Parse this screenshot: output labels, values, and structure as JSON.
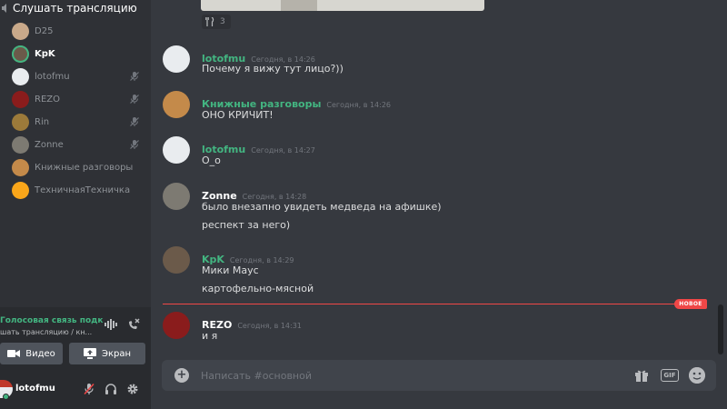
{
  "sidebar": {
    "channel_title": "Слушать трансляцию",
    "voice_users": [
      {
        "name": "D25",
        "highlight": false,
        "muted": false,
        "avatar_color": "#c9a98a"
      },
      {
        "name": "KpK",
        "highlight": true,
        "muted": false,
        "avatar_color": "#6b5a4a"
      },
      {
        "name": "lotofmu",
        "highlight": false,
        "muted": true,
        "avatar_color": "#e9ecef"
      },
      {
        "name": "REZO",
        "highlight": false,
        "muted": true,
        "avatar_color": "#8a1c1c"
      },
      {
        "name": "Rin",
        "highlight": false,
        "muted": true,
        "avatar_color": "#9c7a3a"
      },
      {
        "name": "Zonne",
        "highlight": false,
        "muted": true,
        "avatar_color": "#7d7a72"
      },
      {
        "name": "Книжные разговоры",
        "highlight": false,
        "muted": false,
        "avatar_color": "#c48a4a"
      },
      {
        "name": "ТехничнаяТехничка",
        "highlight": false,
        "muted": false,
        "avatar_color": "#faa61a"
      }
    ],
    "voice_status": "Голосовая связь подк",
    "voice_sub": "шать трансляцию / кн...",
    "video_label": "Видео",
    "screen_label": "Экран",
    "user": {
      "name": "lotofmu"
    }
  },
  "chat": {
    "reaction": {
      "emoji": "fork-and-knife-icon",
      "count": "3"
    },
    "messages": [
      {
        "author": "lotofmu",
        "author_color": "#43b581",
        "timestamp": "Сегодня, в 14:26",
        "avatar_color": "#e9ecef",
        "lines": [
          "Почему я вижу тут лицо?))"
        ]
      },
      {
        "author": "Книжные разговоры",
        "author_color": "#43b581",
        "timestamp": "Сегодня, в 14:26",
        "avatar_color": "#c48a4a",
        "lines": [
          "ОНО КРИЧИТ!"
        ]
      },
      {
        "author": "lotofmu",
        "author_color": "#43b581",
        "timestamp": "Сегодня, в 14:27",
        "avatar_color": "#e9ecef",
        "lines": [
          "О_о"
        ]
      },
      {
        "author": "Zonne",
        "author_color": "#ffffff",
        "timestamp": "Сегодня, в 14:28",
        "avatar_color": "#7d7a72",
        "lines": [
          "было внезапно увидеть медведа на афишке)",
          "респект за него)"
        ]
      },
      {
        "author": "KpK",
        "author_color": "#43b581",
        "timestamp": "Сегодня, в 14:29",
        "avatar_color": "#6b5a4a",
        "lines": [
          "Мики Маус",
          "картофельно-мясной"
        ]
      },
      {
        "author": "REZO",
        "author_color": "#ffffff",
        "timestamp": "Сегодня, в 14:31",
        "avatar_color": "#8a1c1c",
        "lines": [
          "и я"
        ]
      }
    ],
    "new_badge": "НОВОЕ",
    "composer": {
      "placeholder": "Написать #основной",
      "gif_label": "GIF"
    }
  }
}
